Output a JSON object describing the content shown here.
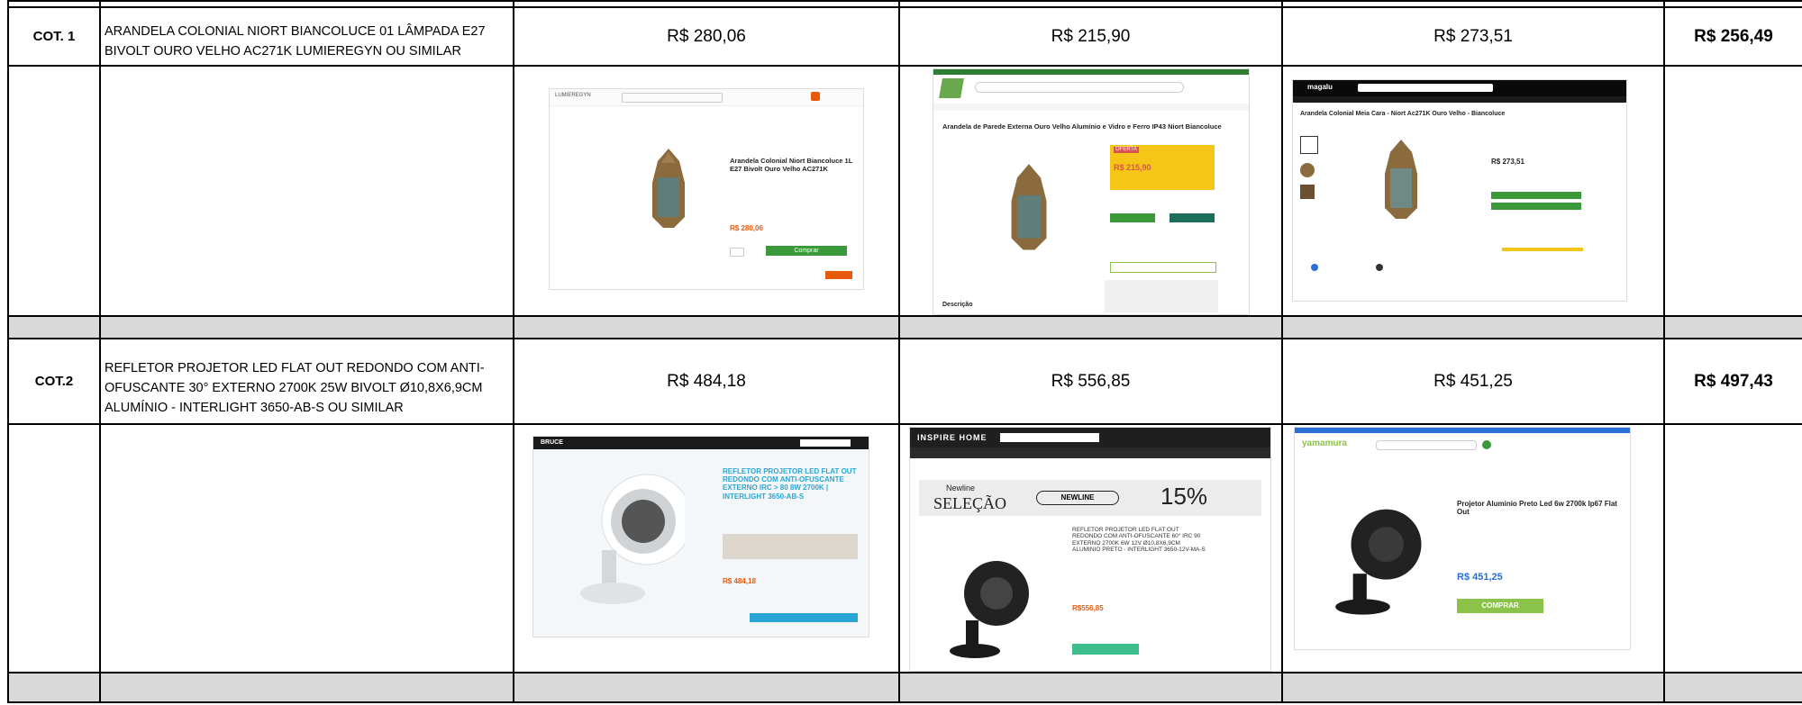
{
  "rows": [
    {
      "code": "COT. 1",
      "description": "ARANDELA COLONIAL NIORT  BIANCOLUCE  01 LÂMPADA E27 BIVOLT OURO VELHO AC271K LUMIEREGYN OU SIMILAR",
      "prices": [
        "R$ 280,06",
        "R$ 215,90",
        "R$ 273,51"
      ],
      "average": "R$ 256,49",
      "screens": [
        {
          "title": "Arandela Colonial Niort Biancoluce 1L E27 Bivolt Ouro Velho AC271K",
          "price": "R$ 280,06",
          "button": "Comprar"
        },
        {
          "title": "Arandela de Parede Externa Ouro Velho Alumínio e Vidro e Ferro IP43 Niort Biancoluce",
          "price": "R$ 215,90",
          "badge": "OFERTA",
          "section": "Descrição"
        },
        {
          "title": "Arandela Colonial Meia Cara - Niort Ac271K Ouro Velho - Biancoluce",
          "price": "R$ 273,51",
          "store": "magalu"
        }
      ]
    },
    {
      "code": "COT.2",
      "description": "REFLETOR PROJETOR LED FLAT OUT REDONDO COM ANTI-OFUSCANTE 30° EXTERNO 2700K 25W BIVOLT Ø10,8X6,9CM ALUMÍNIO - INTERLIGHT 3650-AB-S OU SIMILAR",
      "prices": [
        "R$ 484,18",
        "R$ 556,85",
        "R$ 451,25"
      ],
      "average": "R$ 497,43",
      "screens": [
        {
          "title": "REFLETOR PROJETOR LED FLAT OUT REDONDO COM ANTI-OFUSCANTE EXTERNO IRC > 80 8W 2700K | INTERLIGHT 3650-AB-S",
          "price": "R$ 484,18",
          "store": "BRUCE"
        },
        {
          "title": "REFLETOR PROJETOR LED FLAT OUT REDONDO COM ANTI-OFUSCANTE 60° IRC 90 EXTERNO 2700K 6W 12V Ø10,8X6,9CM ALUMINIO PRETO - INTERLIGHT 3650-12V-MA-S",
          "price": "R$556,85",
          "store": "INSPIRE HOME",
          "banner_left": "Newline",
          "banner_mid": "SELEÇÃO",
          "coupon": "NEWLINE",
          "discount": "15%"
        },
        {
          "title": "Projetor Aluminio Preto Led 6w 2700k Ip67 Flat Out",
          "price": "R$ 451,25",
          "store": "yamamura",
          "button": "COMPRAR"
        }
      ]
    }
  ],
  "colors": {
    "grid": "#000000",
    "gap": "#d9d9d9",
    "orange": "#e8590c",
    "green": "#3a9a3a",
    "blue": "#2aa6d6",
    "bronze": "#8b6a3e",
    "dark": "#222222"
  }
}
